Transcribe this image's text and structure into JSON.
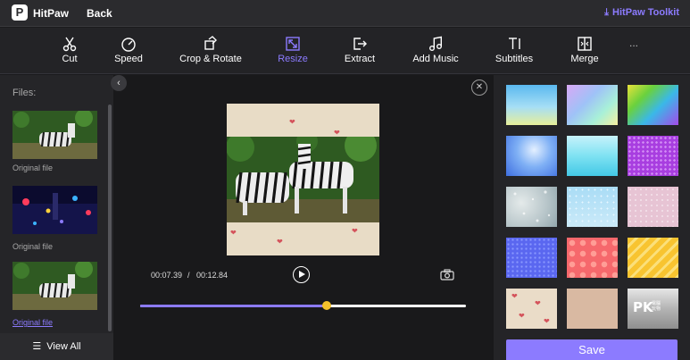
{
  "header": {
    "logo_glyph": "P",
    "app_title": "HitPaw",
    "back_label": "Back",
    "toolkit_label": "HitPaw Toolkit",
    "accent_color": "#8c7bff"
  },
  "toolbar": {
    "tools": [
      {
        "label": "Cut",
        "icon": "scissors-icon"
      },
      {
        "label": "Speed",
        "icon": "speedometer-icon"
      },
      {
        "label": "Crop & Rotate",
        "icon": "crop-rotate-icon"
      },
      {
        "label": "Resize",
        "icon": "resize-icon",
        "active": true
      },
      {
        "label": "Extract",
        "icon": "extract-icon"
      },
      {
        "label": "Add Music",
        "icon": "music-note-icon"
      },
      {
        "label": "Subtitles",
        "icon": "subtitles-icon"
      },
      {
        "label": "Merge",
        "icon": "merge-icon"
      }
    ],
    "more_label": "..."
  },
  "files": {
    "label": "Files:",
    "items": [
      {
        "caption": "Original file",
        "selected": false
      },
      {
        "caption": "Original file",
        "selected": false
      },
      {
        "caption": "Original file",
        "selected": true
      }
    ],
    "view_all_label": "View All"
  },
  "player": {
    "current_time": "00:07.39",
    "separator": "/",
    "total_time": "00:12.84",
    "progress_fraction": 0.572
  },
  "backgrounds": {
    "selected_index": null,
    "items": [
      {
        "name": "sky-gradient"
      },
      {
        "name": "pastel-rainbow"
      },
      {
        "name": "rainbow-diagonal"
      },
      {
        "name": "blue-glow"
      },
      {
        "name": "cyan-gradient"
      },
      {
        "name": "purple-dots"
      },
      {
        "name": "rain-glass"
      },
      {
        "name": "light-blue-speckle"
      },
      {
        "name": "pink-speckle"
      },
      {
        "name": "blue-dots"
      },
      {
        "name": "coral-dots"
      },
      {
        "name": "yellow-stripes"
      },
      {
        "name": "lips-pattern"
      },
      {
        "name": "beige-solid"
      },
      {
        "name": "silver-gradient",
        "watermark": {
          "main": "PK",
          "sub": "電腦\n玩物"
        }
      }
    ],
    "save_label": "Save"
  }
}
